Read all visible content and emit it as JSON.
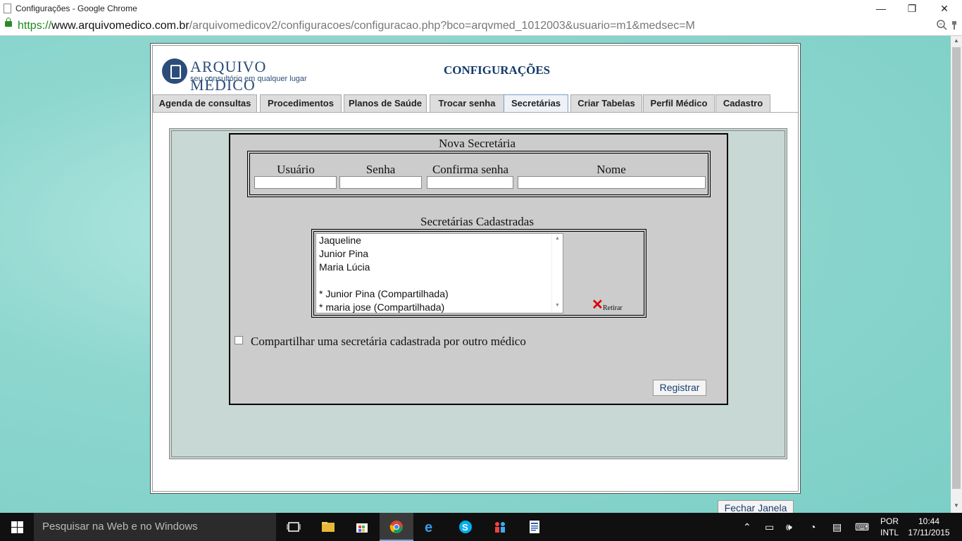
{
  "window": {
    "title": "Configurações - Google Chrome",
    "controls": {
      "minimize": "—",
      "restore": "❐",
      "close": "✕"
    }
  },
  "address": {
    "scheme": "https://",
    "host": "www.arquivomedico.com.br",
    "path": "/arquivomedicov2/configuracoes/configuracao.php?bco=arqvmed_1012003&usuario=m1&medsec=M"
  },
  "header": {
    "logo_name": "ARQUIVO MÉDICO",
    "logo_tagline": "seu consultório em qualquer lugar",
    "page_title": "CONFIGURAÇÕES"
  },
  "tabs": [
    {
      "label": "Agenda de consultas",
      "active": false
    },
    {
      "label": "Procedimentos",
      "active": false
    },
    {
      "label": "Planos de Saúde",
      "active": false
    },
    {
      "label": "Trocar senha",
      "active": false
    },
    {
      "label": "Secretárias",
      "active": true
    },
    {
      "label": "Criar Tabelas",
      "active": false
    },
    {
      "label": "Perfil Médico",
      "active": false
    },
    {
      "label": "Cadastro",
      "active": false
    }
  ],
  "new_secretary": {
    "heading": "Nova Secretária",
    "fields": [
      {
        "label": "Usuário",
        "value": ""
      },
      {
        "label": "Senha",
        "value": ""
      },
      {
        "label": "Confirma senha",
        "value": ""
      },
      {
        "label": "Nome",
        "value": ""
      }
    ]
  },
  "registered": {
    "heading": "Secretárias Cadastradas",
    "items": [
      "Jaqueline",
      "Junior Pina",
      "Maria Lúcia",
      "",
      "* Junior Pina (Compartilhada)",
      "* maria jose (Compartilhada)"
    ],
    "remove_label": "Retirar"
  },
  "share": {
    "label": "Compartilhar uma secretária cadastrada por outro médico",
    "checked": false
  },
  "buttons": {
    "register": "Registrar",
    "close_window": "Fechar Janela"
  },
  "taskbar": {
    "search_placeholder": "Pesquisar na Web e no Windows",
    "lang_line1": "POR",
    "lang_line2": "INTL",
    "time": "10:44",
    "date": "17/11/2015"
  }
}
